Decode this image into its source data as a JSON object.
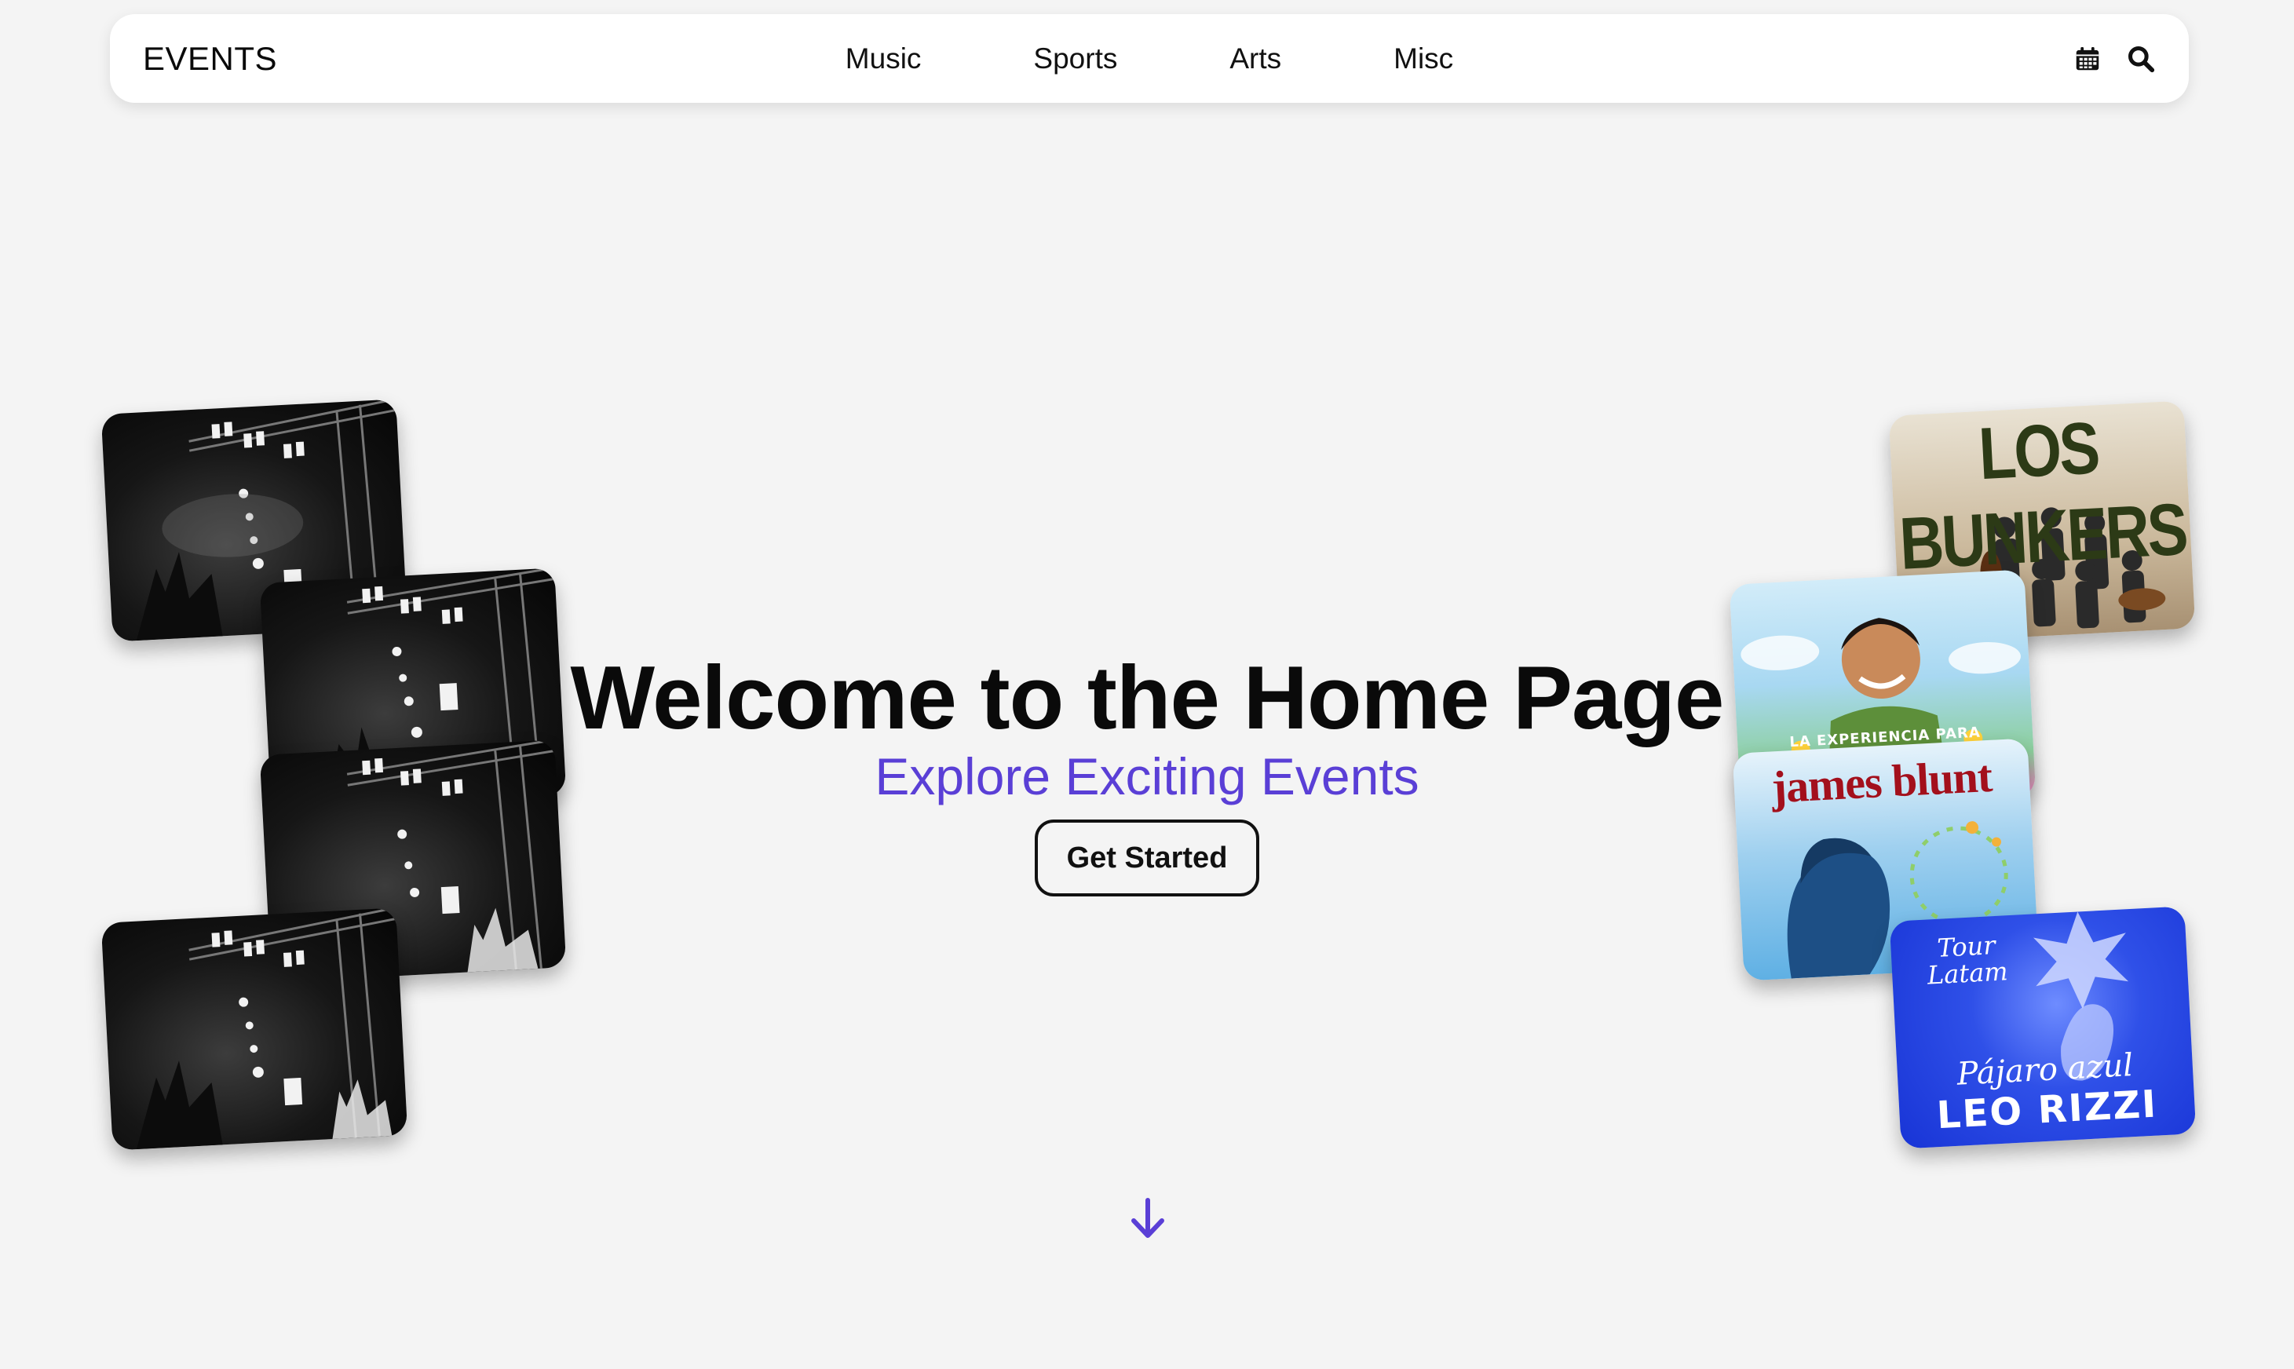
{
  "navbar": {
    "brand": "EVENTS",
    "links": [
      "Music",
      "Sports",
      "Arts",
      "Misc"
    ],
    "icons": [
      "calendar-icon",
      "search-icon"
    ]
  },
  "hero": {
    "title": "Welcome to the Home Page",
    "subtitle": "Explore Exciting Events",
    "cta_label": "Get Started"
  },
  "colors": {
    "accent": "#5a3fd6",
    "background": "#f4f4f4",
    "navbar_bg": "#ffffff",
    "text": "#0a0a0a"
  },
  "left_cards": [
    {
      "image": "concert-stage-photo"
    },
    {
      "image": "concert-stage-photo"
    },
    {
      "image": "concert-stage-photo"
    },
    {
      "image": "concert-stage-photo"
    }
  ],
  "right_cards": [
    {
      "image": "band-poster",
      "text": "LOS BUNKERS"
    },
    {
      "image": "artist-poster",
      "text": "LA EXPERIENCIA PARA"
    },
    {
      "image": "artist-poster",
      "text": "james blunt"
    },
    {
      "image": "tour-poster",
      "tour_text": "Tour Latam",
      "album": "Pájaro azul",
      "artist": "LEO RIZZI"
    }
  ],
  "scroll_icon": "arrow-down-icon"
}
